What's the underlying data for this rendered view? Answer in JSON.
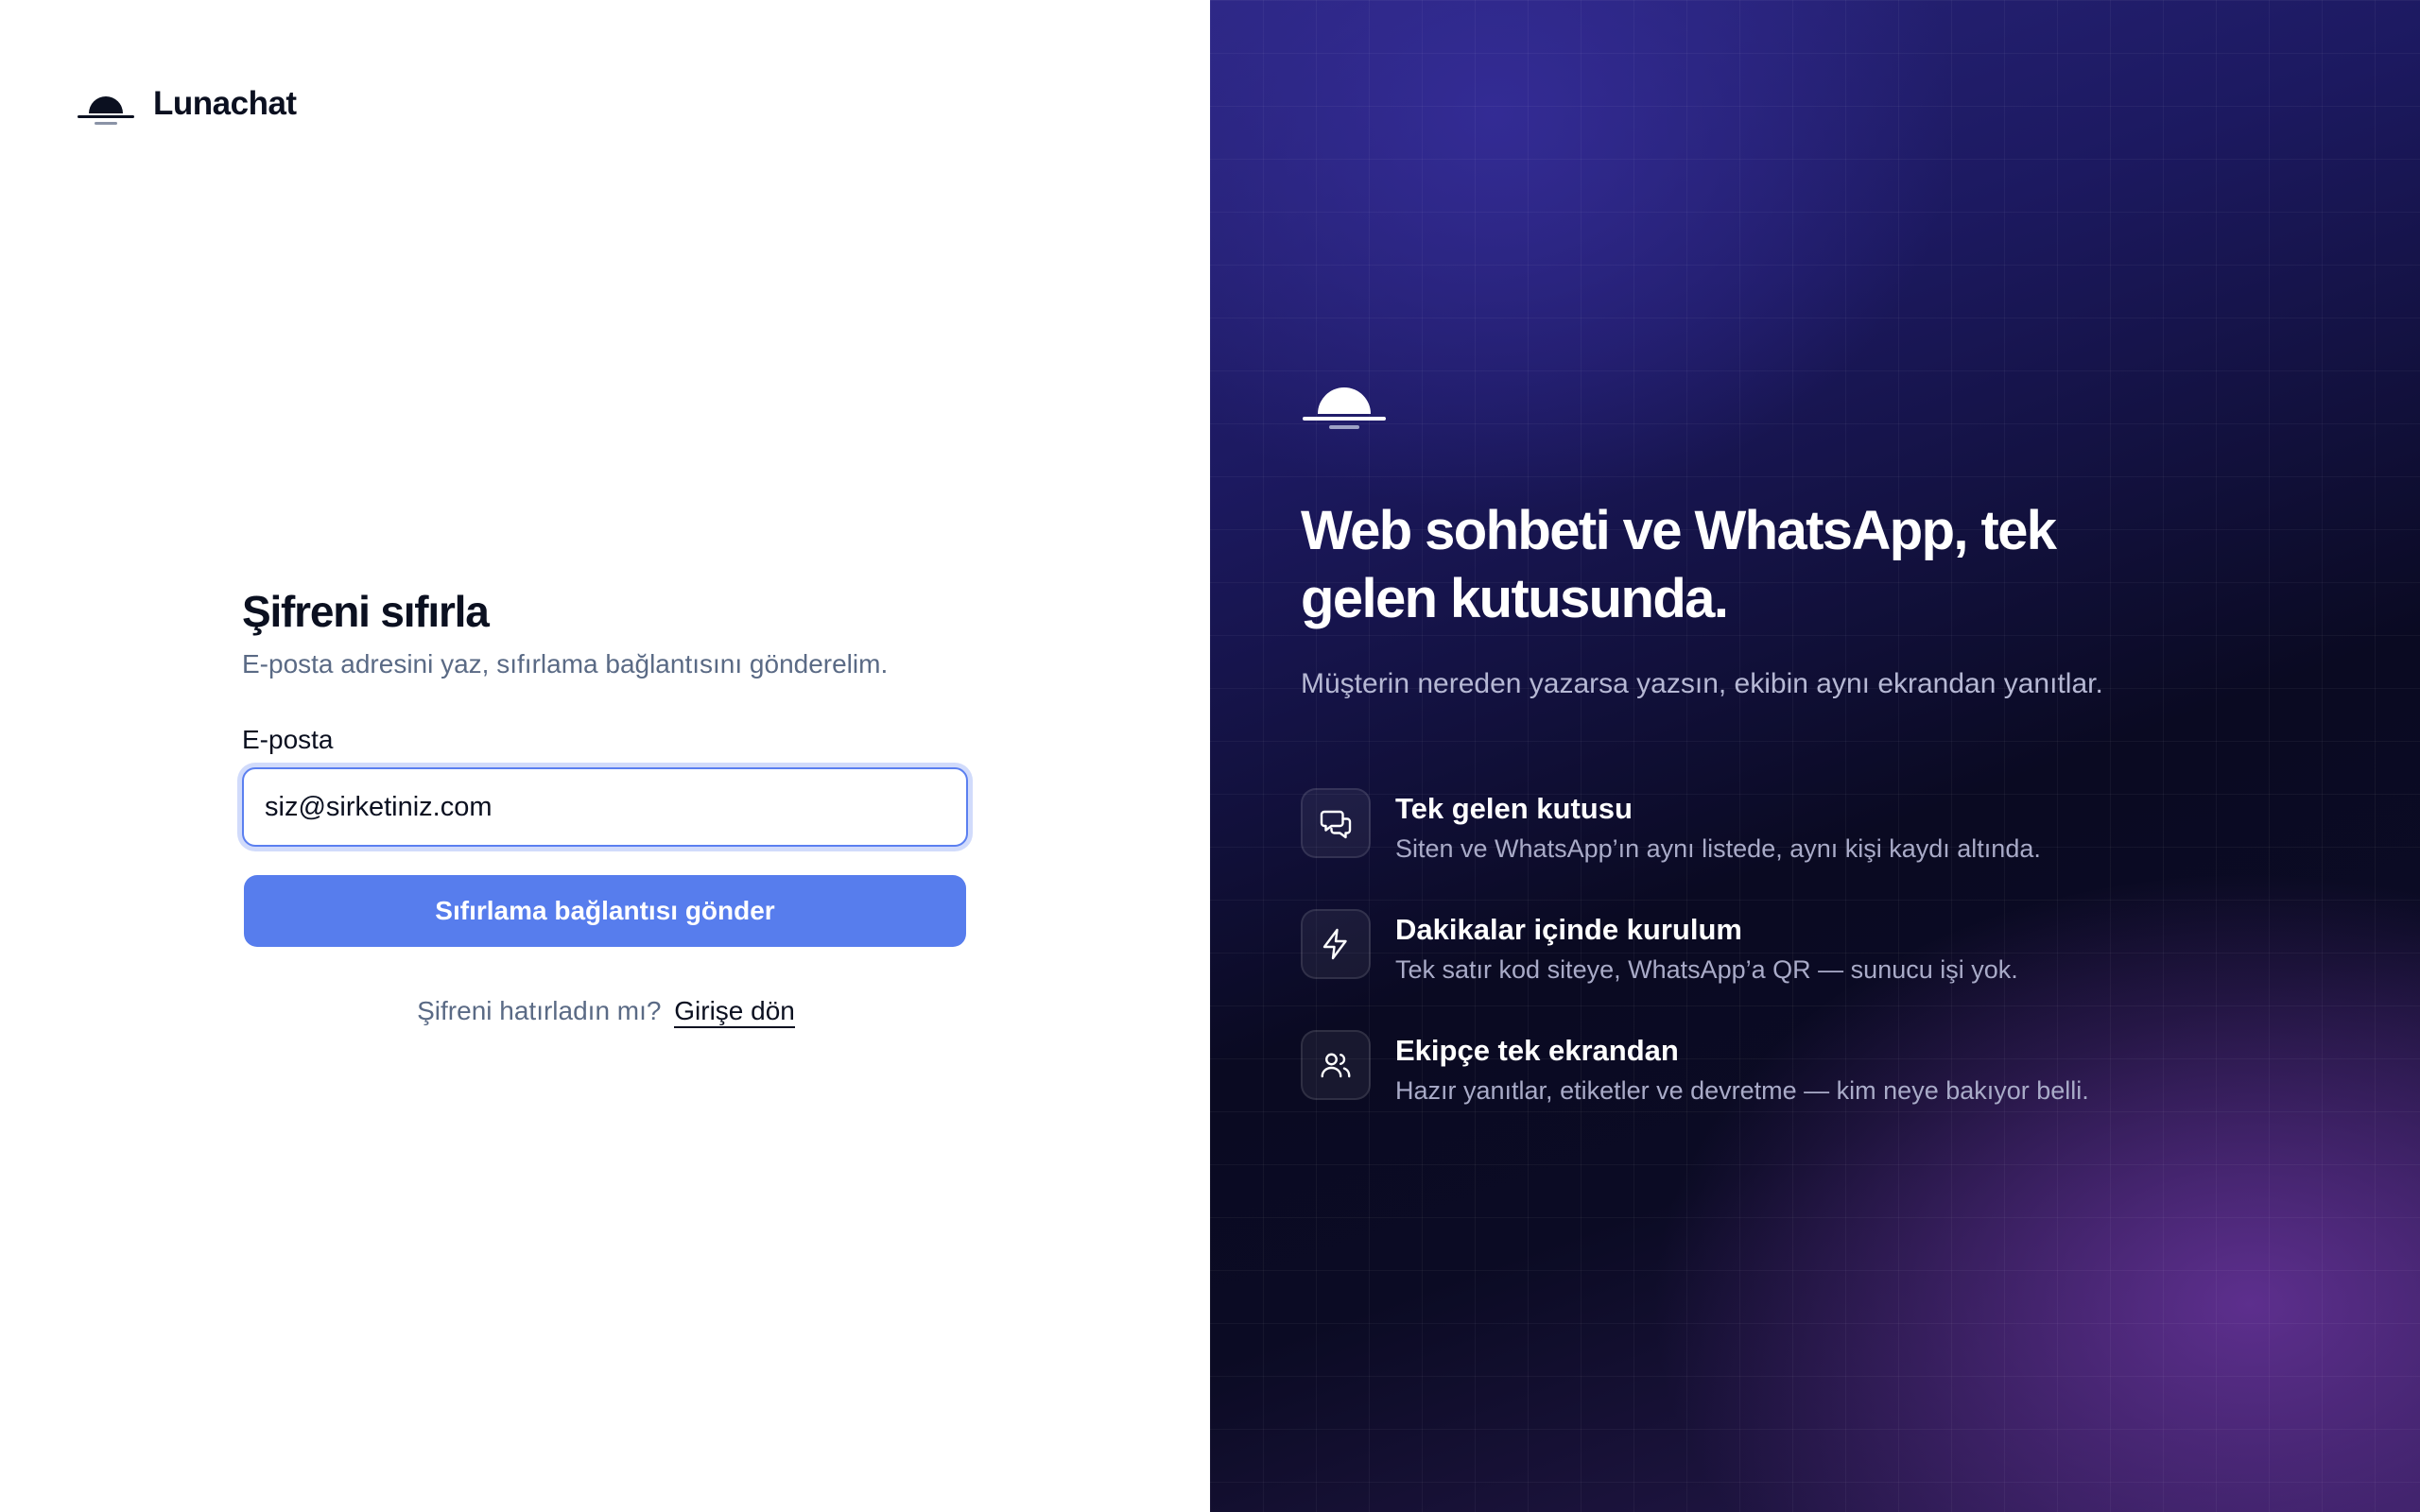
{
  "brand": {
    "name": "Lunachat",
    "logo_icon": "moon-sunset-logo-icon"
  },
  "reset_form": {
    "title": "Şifreni sıfırla",
    "subtitle": "E-posta adresini yaz, sıfırlama bağlantısını gönderelim.",
    "email": {
      "label": "E-posta",
      "value": "siz@sirketiniz.com",
      "placeholder": "siz@sirketiniz.com"
    },
    "submit_label": "Sıfırlama bağlantısı gönder",
    "back_prompt": "Şifreni hatırladın mı?",
    "back_link": "Girişe dön"
  },
  "hero": {
    "logo_icon": "moon-sunset-logo-icon",
    "title": "Web sohbeti ve WhatsApp, tek gelen kutusunda.",
    "subtitle": "Müşterin nereden yazarsa yazsın, ekibin aynı ekrandan yanıtlar.",
    "features": [
      {
        "icon": "chat-bubbles-icon",
        "title": "Tek gelen kutusu",
        "description": "Siten ve WhatsApp’ın aynı listede, aynı kişi kaydı altında."
      },
      {
        "icon": "lightning-icon",
        "title": "Dakikalar içinde kurulum",
        "description": "Tek satır kod siteye, WhatsApp’a QR — sunucu işi yok."
      },
      {
        "icon": "users-icon",
        "title": "Ekipçe tek ekrandan",
        "description": "Hazır yanıtlar, etiketler ve devretme — kim neye bakıyor belli."
      }
    ]
  },
  "colors": {
    "accent": "#577ded",
    "text_primary": "#0b1020",
    "text_muted": "#5a6a85",
    "hero_background_dark": "#0a0a22",
    "hero_background_indigo": "#2b2680",
    "hero_background_purple": "#5a3090"
  }
}
